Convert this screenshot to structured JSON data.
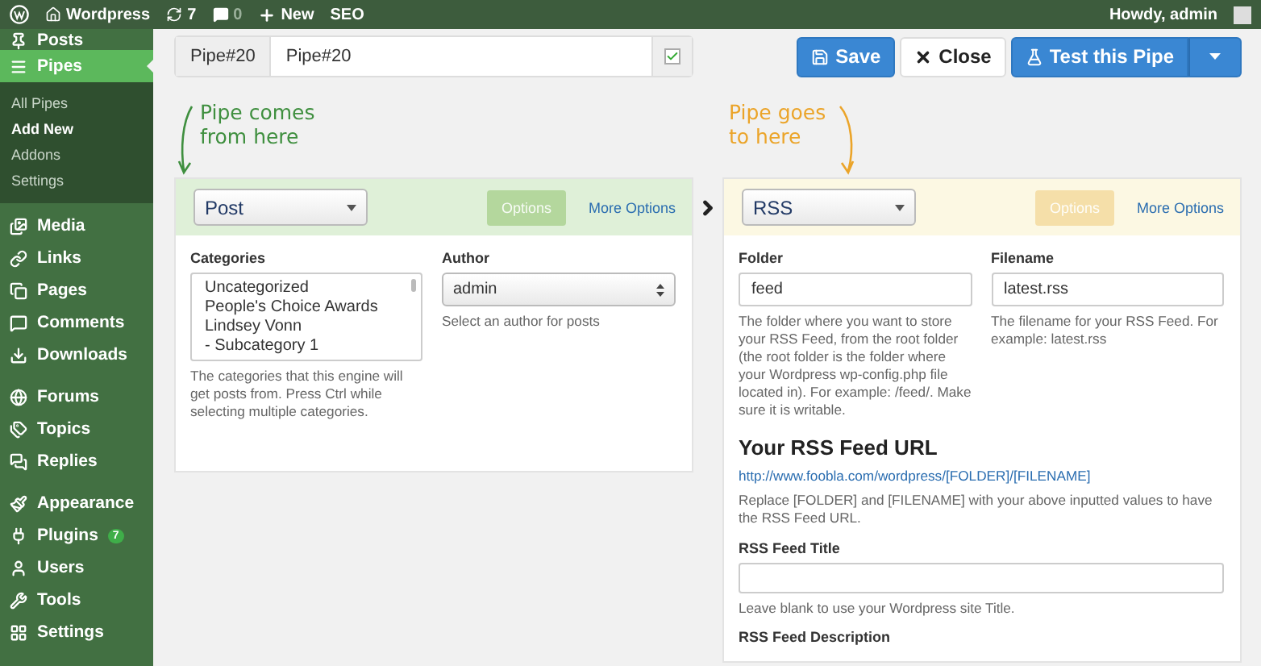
{
  "admin_bar": {
    "items": [
      {
        "kind": "logo"
      },
      {
        "kind": "site",
        "label": "Wordpress"
      },
      {
        "kind": "updates",
        "label": "7"
      },
      {
        "kind": "comments",
        "label": "0"
      },
      {
        "kind": "new",
        "label": "New"
      },
      {
        "kind": "text",
        "label": "SEO"
      }
    ],
    "greeting": "Howdy, admin"
  },
  "sidebar": {
    "groups": [
      [
        {
          "label": "Posts",
          "selected": false
        },
        {
          "label": "Pipes",
          "selected": true,
          "children": [
            {
              "label": "All Pipes",
              "selected": false
            },
            {
              "label": "Add New",
              "selected": true
            },
            {
              "label": "Addons",
              "selected": false
            },
            {
              "label": "Settings",
              "selected": false
            }
          ]
        },
        {
          "label": "Media",
          "selected": false
        },
        {
          "label": "Links",
          "selected": false
        },
        {
          "label": "Pages",
          "selected": false
        },
        {
          "label": "Comments",
          "selected": false
        },
        {
          "label": "Downloads",
          "selected": false
        }
      ],
      [
        {
          "label": "Forums",
          "selected": false
        },
        {
          "label": "Topics",
          "selected": false
        },
        {
          "label": "Replies",
          "selected": false
        }
      ],
      [
        {
          "label": "Appearance",
          "selected": false
        },
        {
          "label": "Plugins",
          "selected": false,
          "badge": "7"
        },
        {
          "label": "Users",
          "selected": false
        },
        {
          "label": "Tools",
          "selected": false
        },
        {
          "label": "Settings",
          "selected": false
        }
      ]
    ]
  },
  "title": {
    "prefix": "Pipe#20",
    "value": "Pipe#20",
    "checked": true
  },
  "buttons": [
    {
      "kind": "save",
      "label": "Save"
    },
    {
      "kind": "close",
      "label": "Close"
    },
    {
      "kind": "test",
      "label": "Test this Pipe"
    }
  ],
  "panels": [
    {
      "color": "#dff0d8",
      "annotation": [
        "Pipe comes",
        "from here"
      ],
      "type": "Post",
      "options": {
        "label": "Options",
        "disabled": true
      },
      "more_options": "More Options",
      "columns": [
        {
          "kind": "listbox",
          "label": "Categories",
          "options": [
            "Uncategorized",
            "People's Choice Awards",
            "Lindsey Vonn",
            "- Subcategory 1"
          ],
          "help": "The categories that this engine will get posts from. Press Ctrl while selecting multiple categories."
        },
        {
          "kind": "select",
          "label": "Author",
          "value": "admin",
          "help": "Select an author for posts"
        }
      ]
    },
    {
      "color": "#fcf8e3",
      "annotation": [
        "Pipe goes",
        "to here"
      ],
      "type": "RSS",
      "options": {
        "label": "Options",
        "disabled": true
      },
      "more_options": "More Options",
      "columns": [
        {
          "kind": "text",
          "label": "Folder",
          "value": "feed",
          "help": "The folder where you want to store your RSS Feed, from the root folder (the root folder is the folder where your Wordpress wp-config.php file located in). For example: /feed/. Make sure it is writable."
        },
        {
          "kind": "text",
          "label": "Filename",
          "value": "latest.rss",
          "help": "The filename for your RSS Feed. For example: latest.rss"
        }
      ],
      "rows": [
        {
          "kind": "heading",
          "label": "Your RSS Feed URL"
        },
        {
          "kind": "link",
          "label": "http://www.foobla.com/wordpress/[FOLDER]/[FILENAME]"
        },
        {
          "kind": "note",
          "label": "Replace [FOLDER] and [FILENAME] with your above inputted values to have the RSS Feed URL."
        },
        {
          "kind": "text",
          "label": "RSS Feed Title",
          "help": "Leave blank to use your Wordpress site Title."
        },
        {
          "kind": "label",
          "label": "RSS Feed Description"
        }
      ]
    }
  ]
}
